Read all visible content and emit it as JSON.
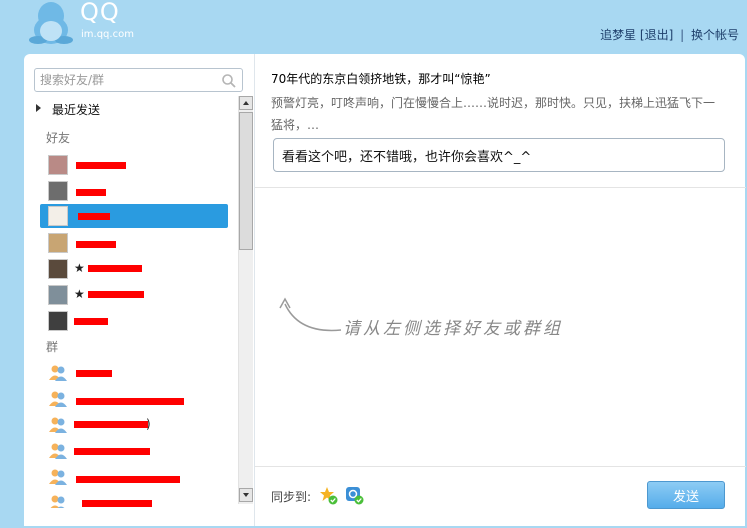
{
  "header": {
    "logo_text": "QQ",
    "logo_subtitle": "im.qq.com",
    "username": "追梦星",
    "logout": "[退出]",
    "separator": "|",
    "switch_account": "换个帐号"
  },
  "search": {
    "placeholder": "搜索好友/群"
  },
  "recent": {
    "label": "最近发送"
  },
  "friends": {
    "heading": "好友",
    "items": [
      {
        "label": "",
        "redacted": true
      },
      {
        "label": "",
        "redacted": true
      },
      {
        "label": "",
        "redacted": true,
        "selected": true
      },
      {
        "label": "",
        "redacted": true
      },
      {
        "label": "★",
        "redacted": true
      },
      {
        "label": "★",
        "redacted": true
      },
      {
        "label": "",
        "redacted": true
      }
    ]
  },
  "groups": {
    "heading": "群",
    "items": [
      {
        "label": "",
        "redacted": true
      },
      {
        "label": "",
        "redacted": true
      },
      {
        "label": ")",
        "redacted": true
      },
      {
        "label": "",
        "redacted": true
      },
      {
        "label": "",
        "redacted": true
      },
      {
        "label": "",
        "redacted": true
      }
    ]
  },
  "share": {
    "title": "70年代的东京白领挤地铁，那才叫“惊艳”",
    "description": "预警灯亮，叮咚声响，门在慢慢合上……说时迟，那时快。只见，扶梯上迅猛飞下一猛将，…",
    "message": "看看这个吧，还不错哦，也许你会喜欢^_^"
  },
  "hint": "请从左侧选择好友或群组",
  "footer": {
    "sync_label": "同步到:",
    "send": "发送"
  },
  "colors": {
    "background": "#a8d8f2",
    "selected": "#2a9be0",
    "redaction": "#ff0000",
    "send_button": "#55acea"
  }
}
